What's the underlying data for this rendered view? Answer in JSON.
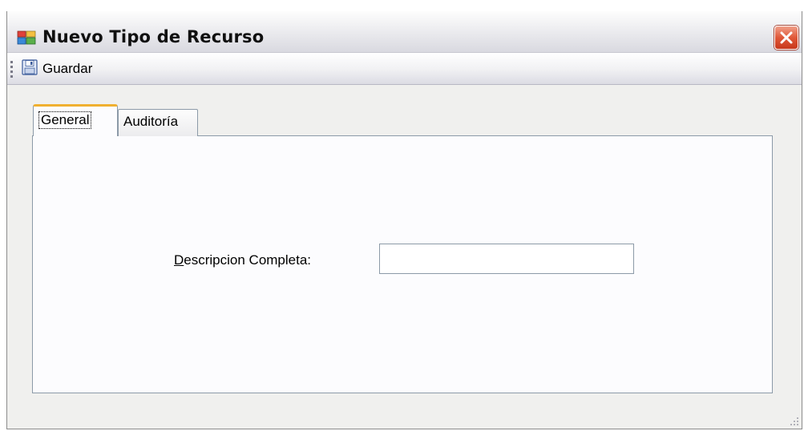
{
  "window": {
    "title": "Nuevo Tipo de Recurso"
  },
  "toolbar": {
    "save_label": "Guardar"
  },
  "tabs": [
    {
      "label": "General",
      "selected": true
    },
    {
      "label": "Auditoría",
      "selected": false
    }
  ],
  "form": {
    "description_label_mnemonic": "D",
    "description_label_rest": "escripcion Completa:",
    "description_value": ""
  },
  "icons": {
    "app": "window-app-icon",
    "close": "close-icon",
    "save": "floppy-disk-icon",
    "grip": "toolbar-grip-icon",
    "resize": "resize-grip-icon"
  },
  "colors": {
    "close_button": "#e05838",
    "selected_tab_accent": "#f0b030",
    "panel_background": "#fcfcfe"
  }
}
